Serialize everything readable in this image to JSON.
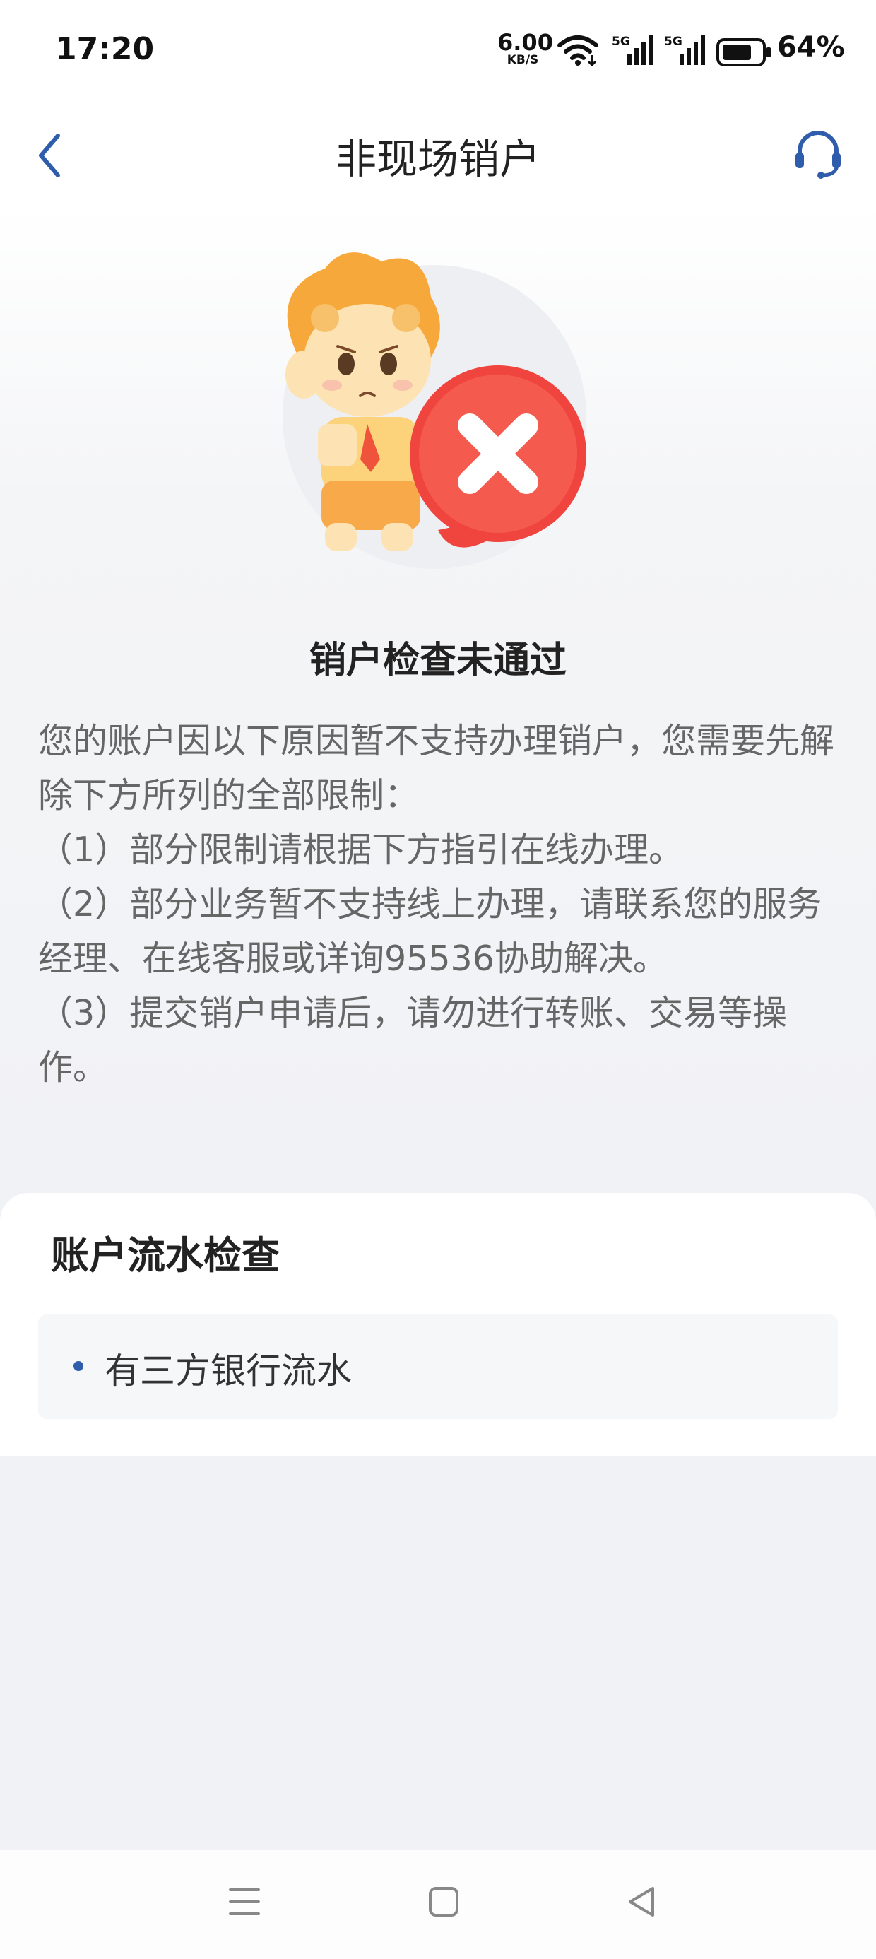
{
  "status_bar": {
    "time": "17:20",
    "net_speed": "6.00",
    "net_unit": "KB/S",
    "signal_label": "5G",
    "battery": "64%"
  },
  "nav": {
    "title": "非现场销户",
    "back_icon": "chevron-left-icon",
    "service_icon": "headset-icon"
  },
  "result": {
    "title": "销户检查未通过"
  },
  "notice": {
    "lines": [
      "您的账户因以下原因暂不支持办理销户，您需要先解除下方所列的全部限制：",
      "（1）部分限制请根据下方指引在线办理。",
      "（2）部分业务暂不支持线上办理，请联系您的服务经理、在线客服或详询95536协助解决。",
      "（3）提交销户申请后，请勿进行转账、交易等操作。"
    ]
  },
  "check_card": {
    "title": "账户流水检查",
    "items": [
      "有三方银行流水"
    ]
  },
  "colors": {
    "accent": "#2f5cab",
    "error": "#f0443e",
    "mascot": "#f5a93c"
  }
}
